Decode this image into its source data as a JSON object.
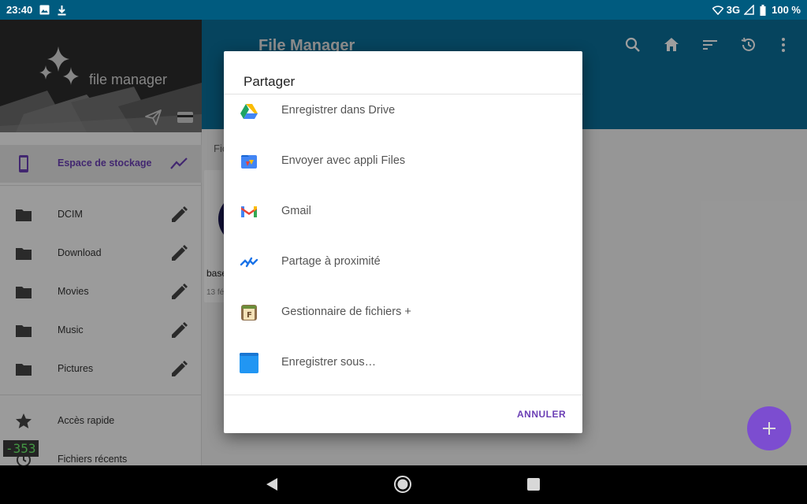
{
  "status_bar": {
    "time": "23:40",
    "network": "3G",
    "battery": "100 %"
  },
  "drawer": {
    "app_title": "file manager",
    "items": [
      {
        "label": "Espace de stockage",
        "icon": "phone-icon",
        "trailing": "chart-icon"
      },
      {
        "label": "DCIM",
        "icon": "folder-icon",
        "trailing": "edit-icon"
      },
      {
        "label": "Download",
        "icon": "folder-icon",
        "trailing": "edit-icon"
      },
      {
        "label": "Movies",
        "icon": "folder-icon",
        "trailing": "edit-icon"
      },
      {
        "label": "Music",
        "icon": "folder-icon",
        "trailing": "edit-icon"
      },
      {
        "label": "Pictures",
        "icon": "folder-icon",
        "trailing": "edit-icon"
      },
      {
        "label": "Accès rapide",
        "icon": "star-icon"
      },
      {
        "label": "Fichiers récents",
        "icon": "history-icon"
      }
    ],
    "counter": "-353"
  },
  "toolbar": {
    "title": "File Manager",
    "icons": [
      "search-icon",
      "home-icon",
      "sort-icon",
      "history-icon",
      "more-icon"
    ]
  },
  "main": {
    "tab_partial": "Fic",
    "item_name_partial": "base",
    "item_date_partial": "13 fé"
  },
  "dialog": {
    "title": "Partager",
    "options": [
      {
        "label": "Enregistrer dans Drive",
        "icon": "google-drive-icon"
      },
      {
        "label": "Envoyer avec appli Files",
        "icon": "files-app-icon"
      },
      {
        "label": "Gmail",
        "icon": "gmail-icon"
      },
      {
        "label": "Partage à proximité",
        "icon": "nearby-share-icon"
      },
      {
        "label": "Gestionnaire de fichiers +",
        "icon": "file-manager-plus-icon"
      },
      {
        "label": "Enregistrer sous…",
        "icon": "save-as-icon"
      }
    ],
    "cancel_label": "ANNULER"
  },
  "colors": {
    "status_bar": "#005b7f",
    "toolbar": "#0a6e98",
    "accent": "#6b3fb5",
    "fab": "#7c4dd0"
  }
}
